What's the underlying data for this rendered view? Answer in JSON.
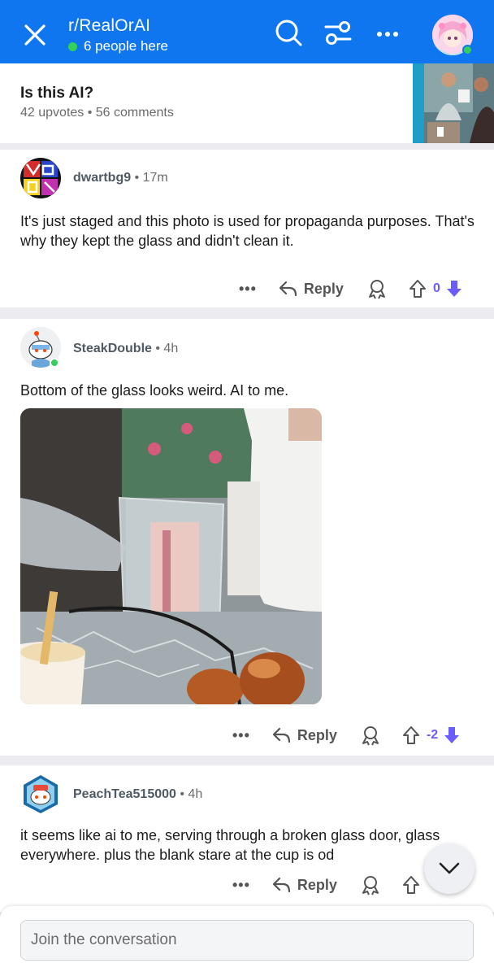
{
  "header": {
    "subreddit": "r/RealOrAI",
    "presence": "6 people here",
    "colors": {
      "bar": "#0f76f0",
      "online": "#34d058"
    }
  },
  "post": {
    "title": "Is this AI?",
    "meta": "42 upvotes • 56 comments"
  },
  "comments": [
    {
      "user": "dwartbg9",
      "time": "• 17m",
      "body": "It's just staged and this photo is used for propaganda purposes.    That's why they kept the glass and didn't clean it.",
      "more": "•••",
      "reply": "Reply",
      "score": "0"
    },
    {
      "user": "SteakDouble",
      "time": "• 4h",
      "body": "Bottom of the glass looks weird. AI to me.",
      "more": "•••",
      "reply": "Reply",
      "score": "-2"
    },
    {
      "user": "PeachTea515000",
      "time": "• 4h",
      "body": "it seems like ai to me, serving through a broken glass door, glass everywhere. plus the blank stare at the cup is od",
      "more": "•••",
      "reply": "Reply",
      "score": ""
    }
  ],
  "composer": {
    "placeholder": "Join the conversation"
  },
  "accent": "#6a5cff"
}
